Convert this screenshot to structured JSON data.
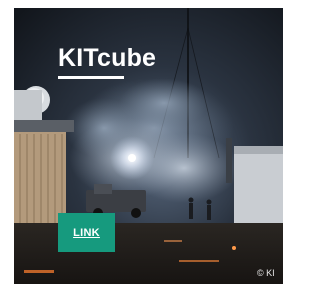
{
  "teaser": {
    "title": "KITcube",
    "link_label": "LINK",
    "copyright": "© KI"
  },
  "colors": {
    "button_green": "#169a7e",
    "title_text": "#ffffff",
    "background_dark": "#1a1e24"
  }
}
